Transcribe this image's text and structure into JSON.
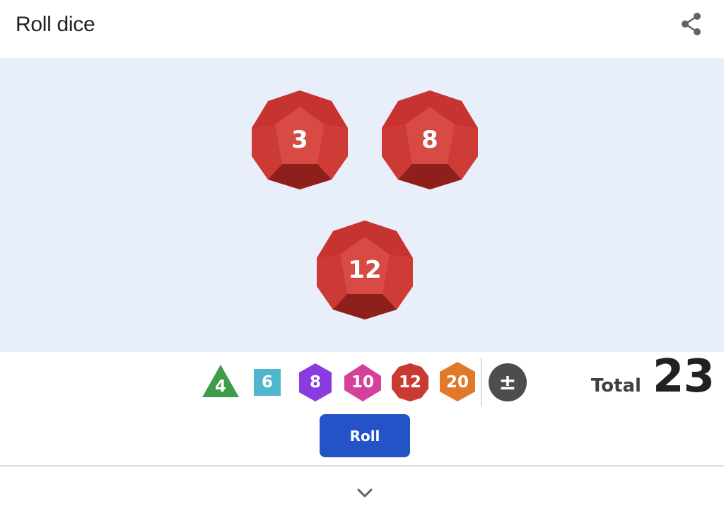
{
  "header": {
    "title": "Roll dice",
    "share_icon": "share-icon"
  },
  "tray": {
    "dice": [
      {
        "type": "d12",
        "value": "3"
      },
      {
        "type": "d12",
        "value": "8"
      },
      {
        "type": "d12",
        "value": "12"
      }
    ],
    "total_label": "Total",
    "total_value": "23",
    "die_color": "#d43d37"
  },
  "selector": {
    "dice_types": [
      {
        "label": "4",
        "shape": "triangle",
        "color": "#3e9d4b"
      },
      {
        "label": "6",
        "shape": "square",
        "color": "#50b6cb"
      },
      {
        "label": "8",
        "shape": "hexagon",
        "color": "#8a3be0"
      },
      {
        "label": "10",
        "shape": "hexagon",
        "color": "#d5409a"
      },
      {
        "label": "12",
        "shape": "octagon",
        "color": "#c93a33"
      },
      {
        "label": "20",
        "shape": "hexagon",
        "color": "#e0792a"
      }
    ],
    "modifier_label": "±",
    "modifier_color": "#4d4d4d"
  },
  "roll_button": {
    "label": "Roll",
    "color": "#2452c7"
  },
  "footer": {
    "expand_icon": "chevron-down-icon"
  }
}
